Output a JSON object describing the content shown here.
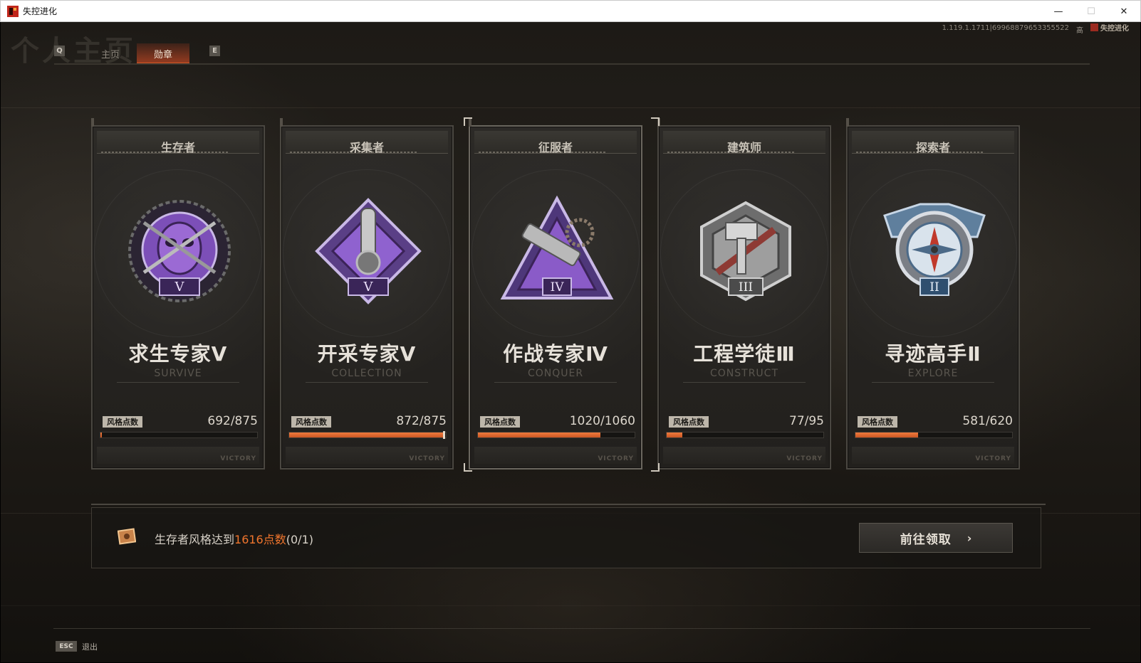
{
  "window": {
    "title": "失控进化",
    "controls": {
      "minimize": "—",
      "maximize": "☐",
      "close": "✕"
    }
  },
  "header": {
    "page_title": "个人主页",
    "version": "1.119.1.1711|69968879653355522",
    "quality": "高",
    "logo_text": "失控进化"
  },
  "tabs": {
    "prev_key": "Q",
    "next_key": "E",
    "items": [
      {
        "label": "主页",
        "active": false
      },
      {
        "label": "勋章",
        "active": true
      }
    ]
  },
  "cards": [
    {
      "role": "生存者",
      "name": "求生专家Ⅴ",
      "en": "SURVIVE",
      "points_label": "风格点数",
      "points": "692/875",
      "progress": 0.01,
      "rank": "V",
      "medal_color": "#8a5bc8",
      "selected": false
    },
    {
      "role": "采集者",
      "name": "开采专家Ⅴ",
      "en": "COLLECTION",
      "points_label": "风格点数",
      "points": "872/875",
      "progress": 0.985,
      "rank": "V",
      "medal_color": "#8a5bc8",
      "selected": false
    },
    {
      "role": "征服者",
      "name": "作战专家Ⅳ",
      "en": "CONQUER",
      "points_label": "风格点数",
      "points": "1020/1060",
      "progress": 0.78,
      "rank": "IV",
      "medal_color": "#8a5bc8",
      "selected": true
    },
    {
      "role": "建筑师",
      "name": "工程学徒Ⅲ",
      "en": "CONSTRUCT",
      "points_label": "风格点数",
      "points": "77/95",
      "progress": 0.1,
      "rank": "III",
      "medal_color": "#9a9a9a",
      "selected": false
    },
    {
      "role": "探索者",
      "name": "寻迹高手Ⅱ",
      "en": "EXPLORE",
      "points_label": "风格点数",
      "points": "581/620",
      "progress": 0.4,
      "rank": "II",
      "medal_color": "#6c9ac6",
      "selected": false
    }
  ],
  "card_footer": "VICTORY",
  "task": {
    "text_before": "生存者风格达到",
    "highlight": "1616点数",
    "text_after": "(0/1)",
    "button_label": "前往领取",
    "button_arrow": "›",
    "highlight_color": "#f0752d"
  },
  "footer": {
    "esc_key": "ESC",
    "esc_label": "退出"
  },
  "icons": [
    "app-icon",
    "minimize-icon",
    "maximize-icon",
    "close-icon",
    "medal-icon",
    "task-box-icon",
    "chevron-right-icon"
  ]
}
